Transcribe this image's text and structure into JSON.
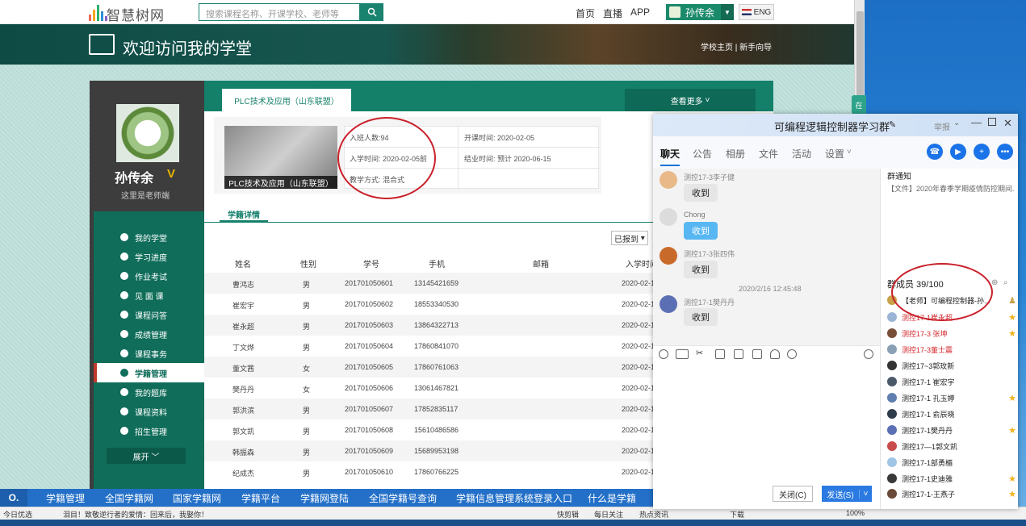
{
  "site": {
    "logo_text": "智慧树网",
    "search_placeholder": "搜索课程名称、开课学校、老师等",
    "nav": [
      "首页",
      "直播",
      "APP"
    ],
    "user_name": "孙传余",
    "lang": "ENG"
  },
  "banner": {
    "title": "欢迎访问我的学堂",
    "links": "学校主页  |  新手向导"
  },
  "profile": {
    "name": "孙传余",
    "level": "V",
    "subtitle": "这里是老师端"
  },
  "menu": {
    "items": [
      "我的学堂",
      "学习进度",
      "作业考试",
      "见 面 课",
      "课程问答",
      "成绩管理",
      "课程事务",
      "学籍管理",
      "我的题库",
      "课程资料",
      "招生管理"
    ],
    "active_index": 7,
    "expand_label": "展开"
  },
  "course": {
    "tab_label": "PLC技术及应用（山东联盟）",
    "view_more": "查看更多",
    "caption": "PLC技术及应用（山东联盟）",
    "enrolled": "入班人数:94",
    "start_time": "开课时间: 2020-02-05",
    "join_time": "入学时间: 2020-02-05前",
    "end_time": "结业时间: 预计 2020-06-15",
    "teach_mode": "教学方式: 混合式"
  },
  "roster": {
    "subtab": "学籍详情",
    "filter": "已报到",
    "columns": [
      "姓名",
      "性别",
      "学号",
      "手机",
      "邮箱",
      "入学时间"
    ],
    "rows": [
      [
        "曹鸿志",
        "男",
        "201701050601",
        "13145421659",
        "",
        "2020-02-1"
      ],
      [
        "崔宏宇",
        "男",
        "201701050602",
        "18553340530",
        "",
        "2020-02-1"
      ],
      [
        "崔永超",
        "男",
        "201701050603",
        "13864322713",
        "",
        "2020-02-1"
      ],
      [
        "丁文烨",
        "男",
        "201701050604",
        "17860841070",
        "",
        "2020-02-1"
      ],
      [
        "董文茜",
        "女",
        "201701050605",
        "17860761063",
        "",
        "2020-02-1"
      ],
      [
        "樊丹丹",
        "女",
        "201701050606",
        "13061467821",
        "",
        "2020-02-1"
      ],
      [
        "郭洪滨",
        "男",
        "201701050607",
        "17852835117",
        "",
        "2020-02-1"
      ],
      [
        "郭文凯",
        "男",
        "201701050608",
        "15610486586",
        "",
        "2020-02-1"
      ],
      [
        "韩振森",
        "男",
        "201701050609",
        "15689953198",
        "",
        "2020-02-1"
      ],
      [
        "纪成杰",
        "男",
        "201701050610",
        "17860766225",
        "",
        "2020-02-1"
      ]
    ]
  },
  "linkbar": {
    "items": [
      "学籍管理",
      "全国学籍网",
      "国家学籍网",
      "学籍平台",
      "学籍网登陆",
      "全国学籍号查询",
      "学籍信息管理系统登录入口",
      "什么是学籍"
    ]
  },
  "statusbar": {
    "left": "今日优选",
    "news": "泪目！致敬逆行者的爱情：回来后，我娶你！",
    "items": [
      "快剪辑",
      "每日关注",
      "热点资讯",
      "下载"
    ],
    "zoom": "100%"
  },
  "chat": {
    "title": "可编程逻辑控制器学习群",
    "title_extra": "举报",
    "tabs": [
      "聊天",
      "公告",
      "相册",
      "文件",
      "活动",
      "设置"
    ],
    "messages": [
      {
        "name": "测控17-3李子健",
        "text": "收到"
      },
      {
        "name": "Chong",
        "text": "收到"
      },
      {
        "name": "测控17-3张四伟",
        "text": "收到"
      },
      {
        "name": "测控17-1樊丹丹",
        "text": "收到"
      }
    ],
    "timestamp": "2020/2/16 12:45:48",
    "close_btn": "关闭(C)",
    "send_btn": "发送(S)",
    "notice_title": "群通知",
    "notice_body": "【文件】2020年春季学期疫情防控期间...",
    "members_title": "群成员 39/100",
    "members": [
      {
        "name": "【老师】可编程控制器-孙...",
        "red": false,
        "star": false
      },
      {
        "name": "测控17-1崔永超",
        "red": true,
        "star": true
      },
      {
        "name": "测控17-3 张坤",
        "red": true,
        "star": true
      },
      {
        "name": "测控17-3董士震",
        "red": true,
        "star": false
      },
      {
        "name": "测控17~3郭玫新",
        "red": false,
        "star": false
      },
      {
        "name": "测控17-1 崔宏宇",
        "red": false,
        "star": false
      },
      {
        "name": "测控17-1 孔玉婷",
        "red": false,
        "star": true
      },
      {
        "name": "测控17-1 俞辰晓",
        "red": false,
        "star": false
      },
      {
        "name": "测控17-1樊丹丹",
        "red": false,
        "star": true
      },
      {
        "name": "测控17—1郭文凯",
        "red": false,
        "star": false
      },
      {
        "name": "测控17-1部勇楣",
        "red": false,
        "star": false
      },
      {
        "name": "测控17-1史迪雅",
        "red": false,
        "star": true
      },
      {
        "name": "测控17-1-王燕子",
        "red": false,
        "star": true
      }
    ]
  }
}
